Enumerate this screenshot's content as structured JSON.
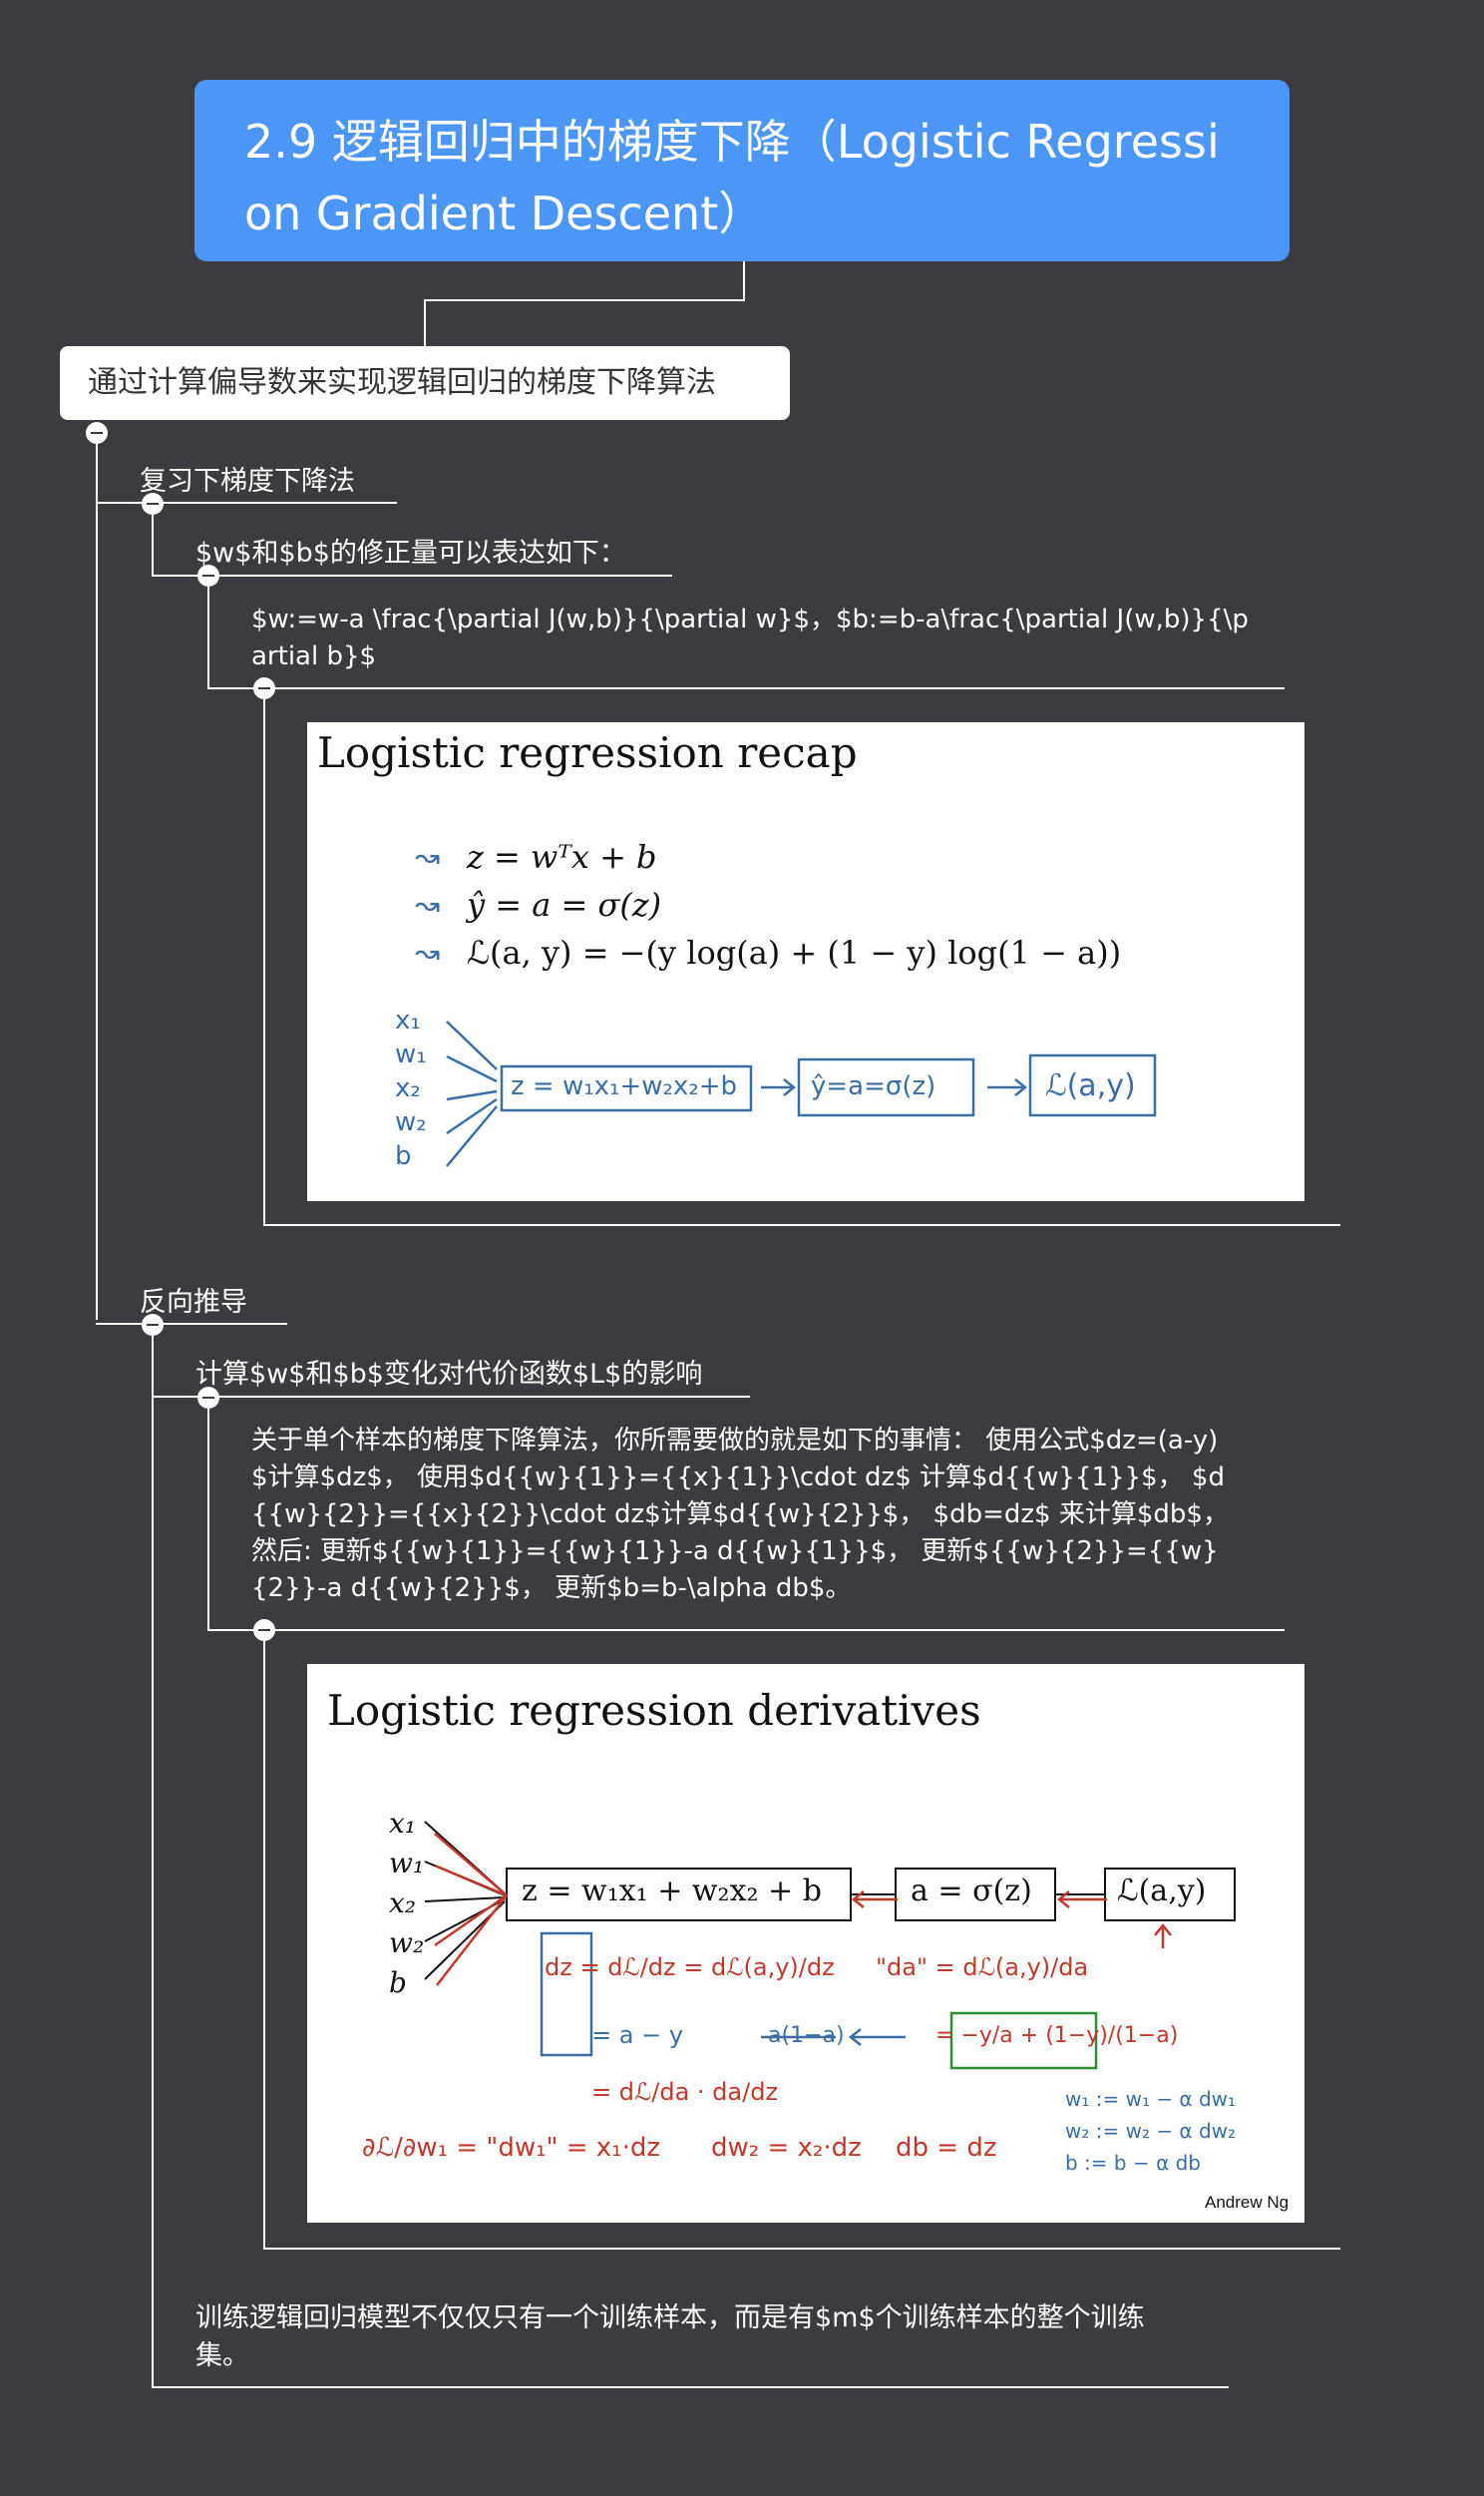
{
  "title": "2.9 逻辑回归中的梯度下降（Logistic Regression Gradient Descent）",
  "root": "通过计算偏导数来实现逻辑回归的梯度下降算法",
  "nodes": {
    "review": "复习下梯度下降法",
    "update_intro": "$w$和$b$的修正量可以表达如下：",
    "update_formula": "$w:=w-a \\frac{\\partial J(w,b)}{\\partial w}$，$b:=b-a\\frac{\\partial J(w,b)}{\\partial b}$",
    "backprop": "反向推导",
    "effect": "计算$w$和$b$变化对代价函数$L$的影响",
    "single_sample": "关于单个样本的梯度下降算法，你所需要做的就是如下的事情： 使用公式$dz=(a-y)$计算$dz$， 使用$d{{w}{1}}={{x}{1}}\\cdot dz$ 计算$d{{w}{1}}$， $d{{w}{2}}={{x}{2}}\\cdot dz$计算$d{{w}{2}}$， $db=dz$ 来计算$db$， 然后: 更新${{w}{1}}={{w}{1}}-a d{{w}{1}}$， 更新${{w}{2}}={{w}{2}}-a d{{w}{2}}$， 更新$b=b-\\alpha db$。",
    "training_set": "训练逻辑回归模型不仅仅只有一个训练样本，而是有$m$个训练样本的整个训练集。"
  },
  "slide1": {
    "title": "Logistic regression recap",
    "eq1": "z = wᵀx + b",
    "eq2": "ŷ = a = σ(z)",
    "eq3": "ℒ(a, y) = −(y log(a) + (1 − y) log(1 − a))",
    "inputs": [
      "x₁",
      "w₁",
      "x₂",
      "w₂",
      "b"
    ],
    "box1": "z = w₁x₁+w₂x₂+b",
    "box2": "ŷ=a=σ(z)",
    "box3": "ℒ(a,y)"
  },
  "slide2": {
    "title": "Logistic regression derivatives",
    "inputs": [
      "x₁",
      "w₁",
      "x₂",
      "w₂",
      "b"
    ],
    "box1": "z = w₁x₁ + w₂x₂ + b",
    "box2": "a = σ(z)",
    "box3": "ℒ(a,y)",
    "dz_eq": "dz = dℒ/dz = dℒ(a,y)/dz",
    "da_eq": "\"da\" = dℒ(a,y)/da",
    "a_minus_y": "= a − y",
    "chain": "= dℒ/da · da/dz",
    "a1a": "a(1−a)",
    "da_value": "= −y/a + (1−y)/(1−a)",
    "dw1": "∂ℒ/∂w₁ = \"dw₁\" = x₁·dz",
    "dw2": "dw₂ = x₂·dz",
    "db": "db = dz",
    "upd1": "w₁ := w₁ − α dw₁",
    "upd2": "w₂ := w₂ − α dw₂",
    "upd3": "b := b − α db",
    "credit": "Andrew Ng"
  },
  "colors": {
    "background": "#3a3c40",
    "title_bg": "#4b96f6",
    "line": "#ffffff"
  }
}
